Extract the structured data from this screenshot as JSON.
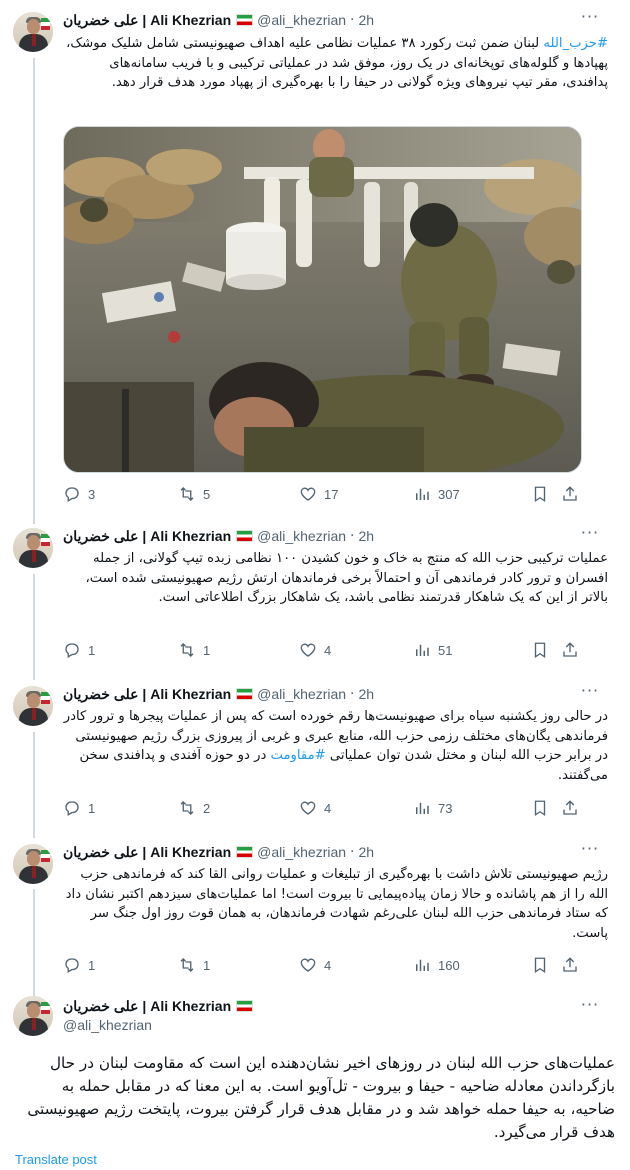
{
  "author": {
    "name": "علی خضریان | Ali Khezrian",
    "handle": "@ali_khezrian",
    "flag": "iran-flag-icon"
  },
  "tweets": [
    {
      "time": "2h",
      "text_before_hashtag": "",
      "hashtag": "#حزب_الله",
      "text": " لبنان ضمن ثبت رکورد ۳۸ عملیات نظامی علیه اهداف صهیونیستی شامل شلیک موشک، پهپادها و گلوله‌های توپخانه‌ای در یک روز، موفق شد در عملیاتی ترکیبی و با فریب سامانه‌های پدافندی، مقر تیپ نیروهای ویژه گولانی در حیفا را با بهره‌گیری از پهپاد مورد هدف قرار دهد.",
      "has_image": true,
      "image_alt": "Soldiers sitting on the floor of a cluttered room",
      "replies": "3",
      "reposts": "5",
      "likes": "17",
      "views": "307"
    },
    {
      "time": "2h",
      "text": "عملیات ترکیبی حزب الله که منتج به خاک و خون کشیدن ۱۰۰ نظامی زبده تیپ گولانی، از جمله افسران و ترور کادر فرماندهی آن و احتمالاً برخی فرماندهان ارتش رژیم صهیونیستی شده است، بالاتر از این که یک شاهکار قدرتمند نظامی باشد، یک شاهکار بزرگ اطلاعاتی است.",
      "replies": "1",
      "reposts": "1",
      "likes": "4",
      "views": "51"
    },
    {
      "time": "2h",
      "text_before_hashtag": "در حالی روز یکشنبه سیاه برای صهیونیست‌ها رقم خورده است که پس از عملیات پیجرها و ترور کادر فرماندهی یگان‌های مختلف رزمی حزب الله، منابع عبری و غربی از پیروزی بزرگ رژیم صهیونیستی در برابر حزب الله لبنان و مختل شدن توان عملیاتی ",
      "hashtag": "#مقاومت",
      "text": " در دو حوزه آفندی و پدافندی سخن می‌گفتند.",
      "replies": "1",
      "reposts": "2",
      "likes": "4",
      "views": "73"
    },
    {
      "time": "2h",
      "text": "رژیم صهیونیستی تلاش داشت با بهره‌گیری از تبلیغات و عملیات روانی القا کند که فرماندهی حزب الله را از هم پاشانده و حالا زمان پیاده‌پیمایی تا بیروت است! اما عملیات‌های سیزدهم اکتبر نشان داد که ستاد فرماندهی حزب الله لبنان علی‌رغم شهادت فرماندهان، به همان قوت روز اول جنگ سر پاست.",
      "replies": "1",
      "reposts": "1",
      "likes": "4",
      "views": "160"
    }
  ],
  "main_tweet": {
    "text": "عملیات‌های حزب الله لبنان در روزهای اخیر نشان‌دهنده این است که مقاومت لبنان در حال بازگرداندن معادله ضاحیه - حیفا و بیروت - تل‌آویو است. به این معنا که در مقابل حمله به ضاحیه، به حیفا حمله خواهد شد و در مقابل هدف قرار گرفتن بیروت، پایتخت رژیم صهیونیستی هدف قرار می‌گیرد.",
    "translate": "Translate post"
  },
  "colors": {
    "accent": "#1d9bf0",
    "secondary_text": "#536471",
    "line": "#cfd9de"
  },
  "icons": [
    "reply-icon",
    "repost-icon",
    "like-icon",
    "views-icon",
    "bookmark-icon",
    "share-icon",
    "more-icon"
  ]
}
